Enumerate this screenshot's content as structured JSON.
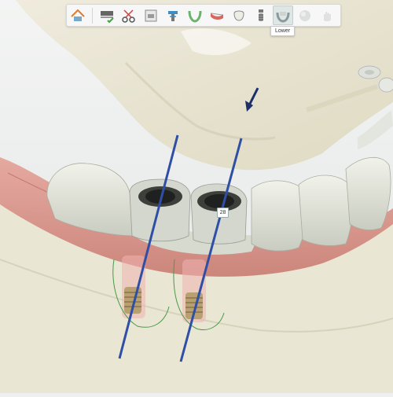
{
  "toolbar": {
    "items": [
      {
        "name": "home",
        "icon": "home-icon"
      },
      {
        "name": "design",
        "icon": "design-check-icon"
      },
      {
        "name": "cut",
        "icon": "scissors-icon"
      },
      {
        "name": "scan",
        "icon": "scan-icon"
      },
      {
        "name": "implant-plan",
        "icon": "implant-plan-icon"
      },
      {
        "name": "arch",
        "icon": "arch-icon"
      },
      {
        "name": "gingiva",
        "icon": "gingiva-icon"
      },
      {
        "name": "tooth",
        "icon": "tooth-icon"
      },
      {
        "name": "implant",
        "icon": "implant-icon"
      },
      {
        "name": "lower",
        "icon": "lower-jaw-icon"
      },
      {
        "name": "sphere",
        "icon": "sphere-icon"
      },
      {
        "name": "hand",
        "icon": "hand-icon"
      }
    ],
    "tooltip": "Lower"
  },
  "scene": {
    "implant_label": "28"
  },
  "colors": {
    "bone": "#e6e2c8",
    "gingiva": "#d98a82",
    "teeth": "#e4e6dc",
    "implant_axis": "#2f4fa6",
    "implant_thread": "#b9a070"
  }
}
